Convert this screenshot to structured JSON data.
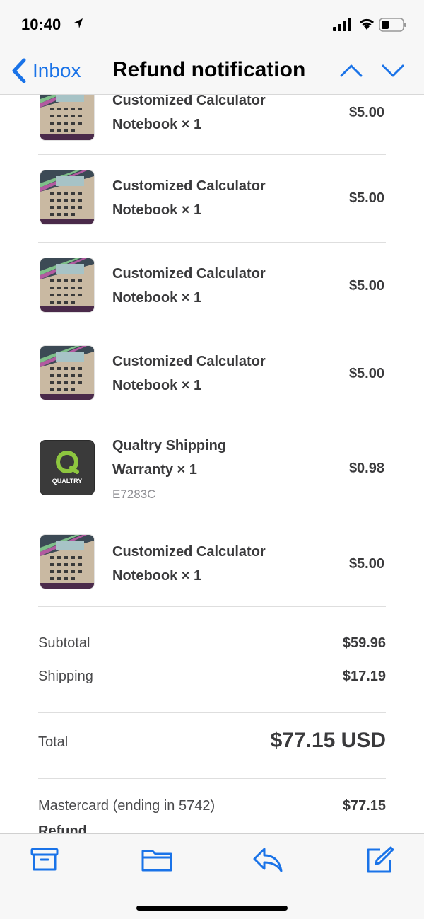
{
  "status_bar": {
    "time": "10:40"
  },
  "nav": {
    "back_label": "Inbox",
    "title": "Refund notification"
  },
  "items": [
    {
      "line1": "Customized Calculator",
      "line2": "Notebook × 1",
      "price": "$5.00",
      "thumb": "calculator-notebook"
    },
    {
      "line1": "Customized Calculator",
      "line2": "Notebook × 1",
      "price": "$5.00",
      "thumb": "calculator-notebook"
    },
    {
      "line1": "Customized Calculator",
      "line2": "Notebook × 1",
      "price": "$5.00",
      "thumb": "calculator-notebook"
    },
    {
      "line1": "Customized Calculator",
      "line2": "Notebook × 1",
      "price": "$5.00",
      "thumb": "calculator-notebook"
    },
    {
      "line1": "Qualtry Shipping",
      "line2": "Warranty × 1",
      "sku": "E7283C",
      "price": "$0.98",
      "thumb": "qualtry-logo",
      "logo_text": "QUALTRY"
    },
    {
      "line1": "Customized Calculator",
      "line2": "Notebook × 1",
      "price": "$5.00",
      "thumb": "calculator-notebook"
    }
  ],
  "summary": {
    "subtotal_label": "Subtotal",
    "subtotal_value": "$59.96",
    "shipping_label": "Shipping",
    "shipping_value": "$17.19",
    "total_label": "Total",
    "total_value": "$77.15 USD",
    "payment_label": "Mastercard (ending in 5742)",
    "payment_value": "$77.15",
    "partial_text": "Refund..."
  },
  "toolbar": {
    "icons": [
      "archive-icon",
      "folder-icon",
      "reply-icon",
      "compose-icon"
    ]
  },
  "colors": {
    "accent": "#1a73e8",
    "text": "#3a3a3c",
    "secondary": "#8e8e93",
    "qualtry_green": "#8dc63f"
  }
}
